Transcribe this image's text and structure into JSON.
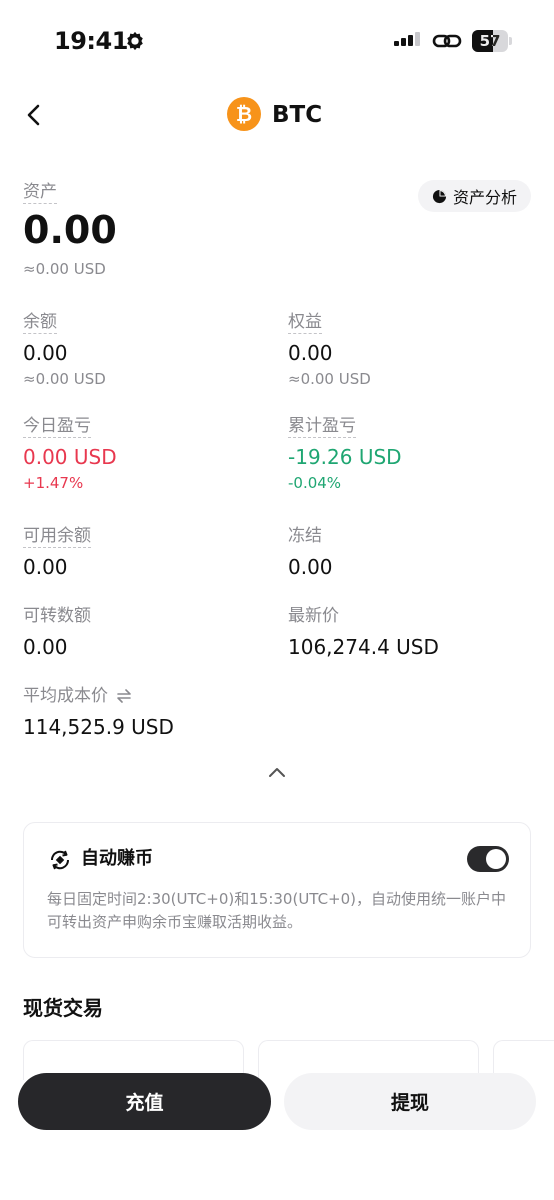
{
  "status_bar": {
    "time": "19:41",
    "battery": "57"
  },
  "header": {
    "coin_symbol_glyph": "₿",
    "coin_name": "BTC",
    "coin_color": "#f7931a"
  },
  "assets": {
    "label": "资产",
    "value": "0.00",
    "usd": "≈0.00 USD",
    "analysis_button": "资产分析"
  },
  "balance": {
    "label": "余额",
    "value": "0.00",
    "usd": "≈0.00 USD"
  },
  "equity": {
    "label": "权益",
    "value": "0.00",
    "usd": "≈0.00 USD"
  },
  "today_pnl": {
    "label": "今日盈亏",
    "value": "0.00 USD",
    "pct": "+1.47%"
  },
  "total_pnl": {
    "label": "累计盈亏",
    "value": "-19.26 USD",
    "pct": "-0.04%"
  },
  "available": {
    "label": "可用余额",
    "value": "0.00"
  },
  "frozen": {
    "label": "冻结",
    "value": "0.00"
  },
  "transferable": {
    "label": "可转数额",
    "value": "0.00"
  },
  "latest_price": {
    "label": "最新价",
    "value": "106,274.4 USD"
  },
  "avg_cost": {
    "label": "平均成本价",
    "value": "114,525.9 USD"
  },
  "auto_earn": {
    "title": "自动赚币",
    "enabled": true,
    "description": "每日固定时间2:30(UTC+0)和15:30(UTC+0)，自动使用统一账户中可转出资产申购余币宝赚取活期收益。"
  },
  "spot": {
    "title": "现货交易"
  },
  "actions": {
    "deposit": "充值",
    "withdraw": "提现"
  },
  "colors": {
    "up": "#e8384f",
    "down": "#1fa672",
    "primary_button": "#27272a"
  }
}
